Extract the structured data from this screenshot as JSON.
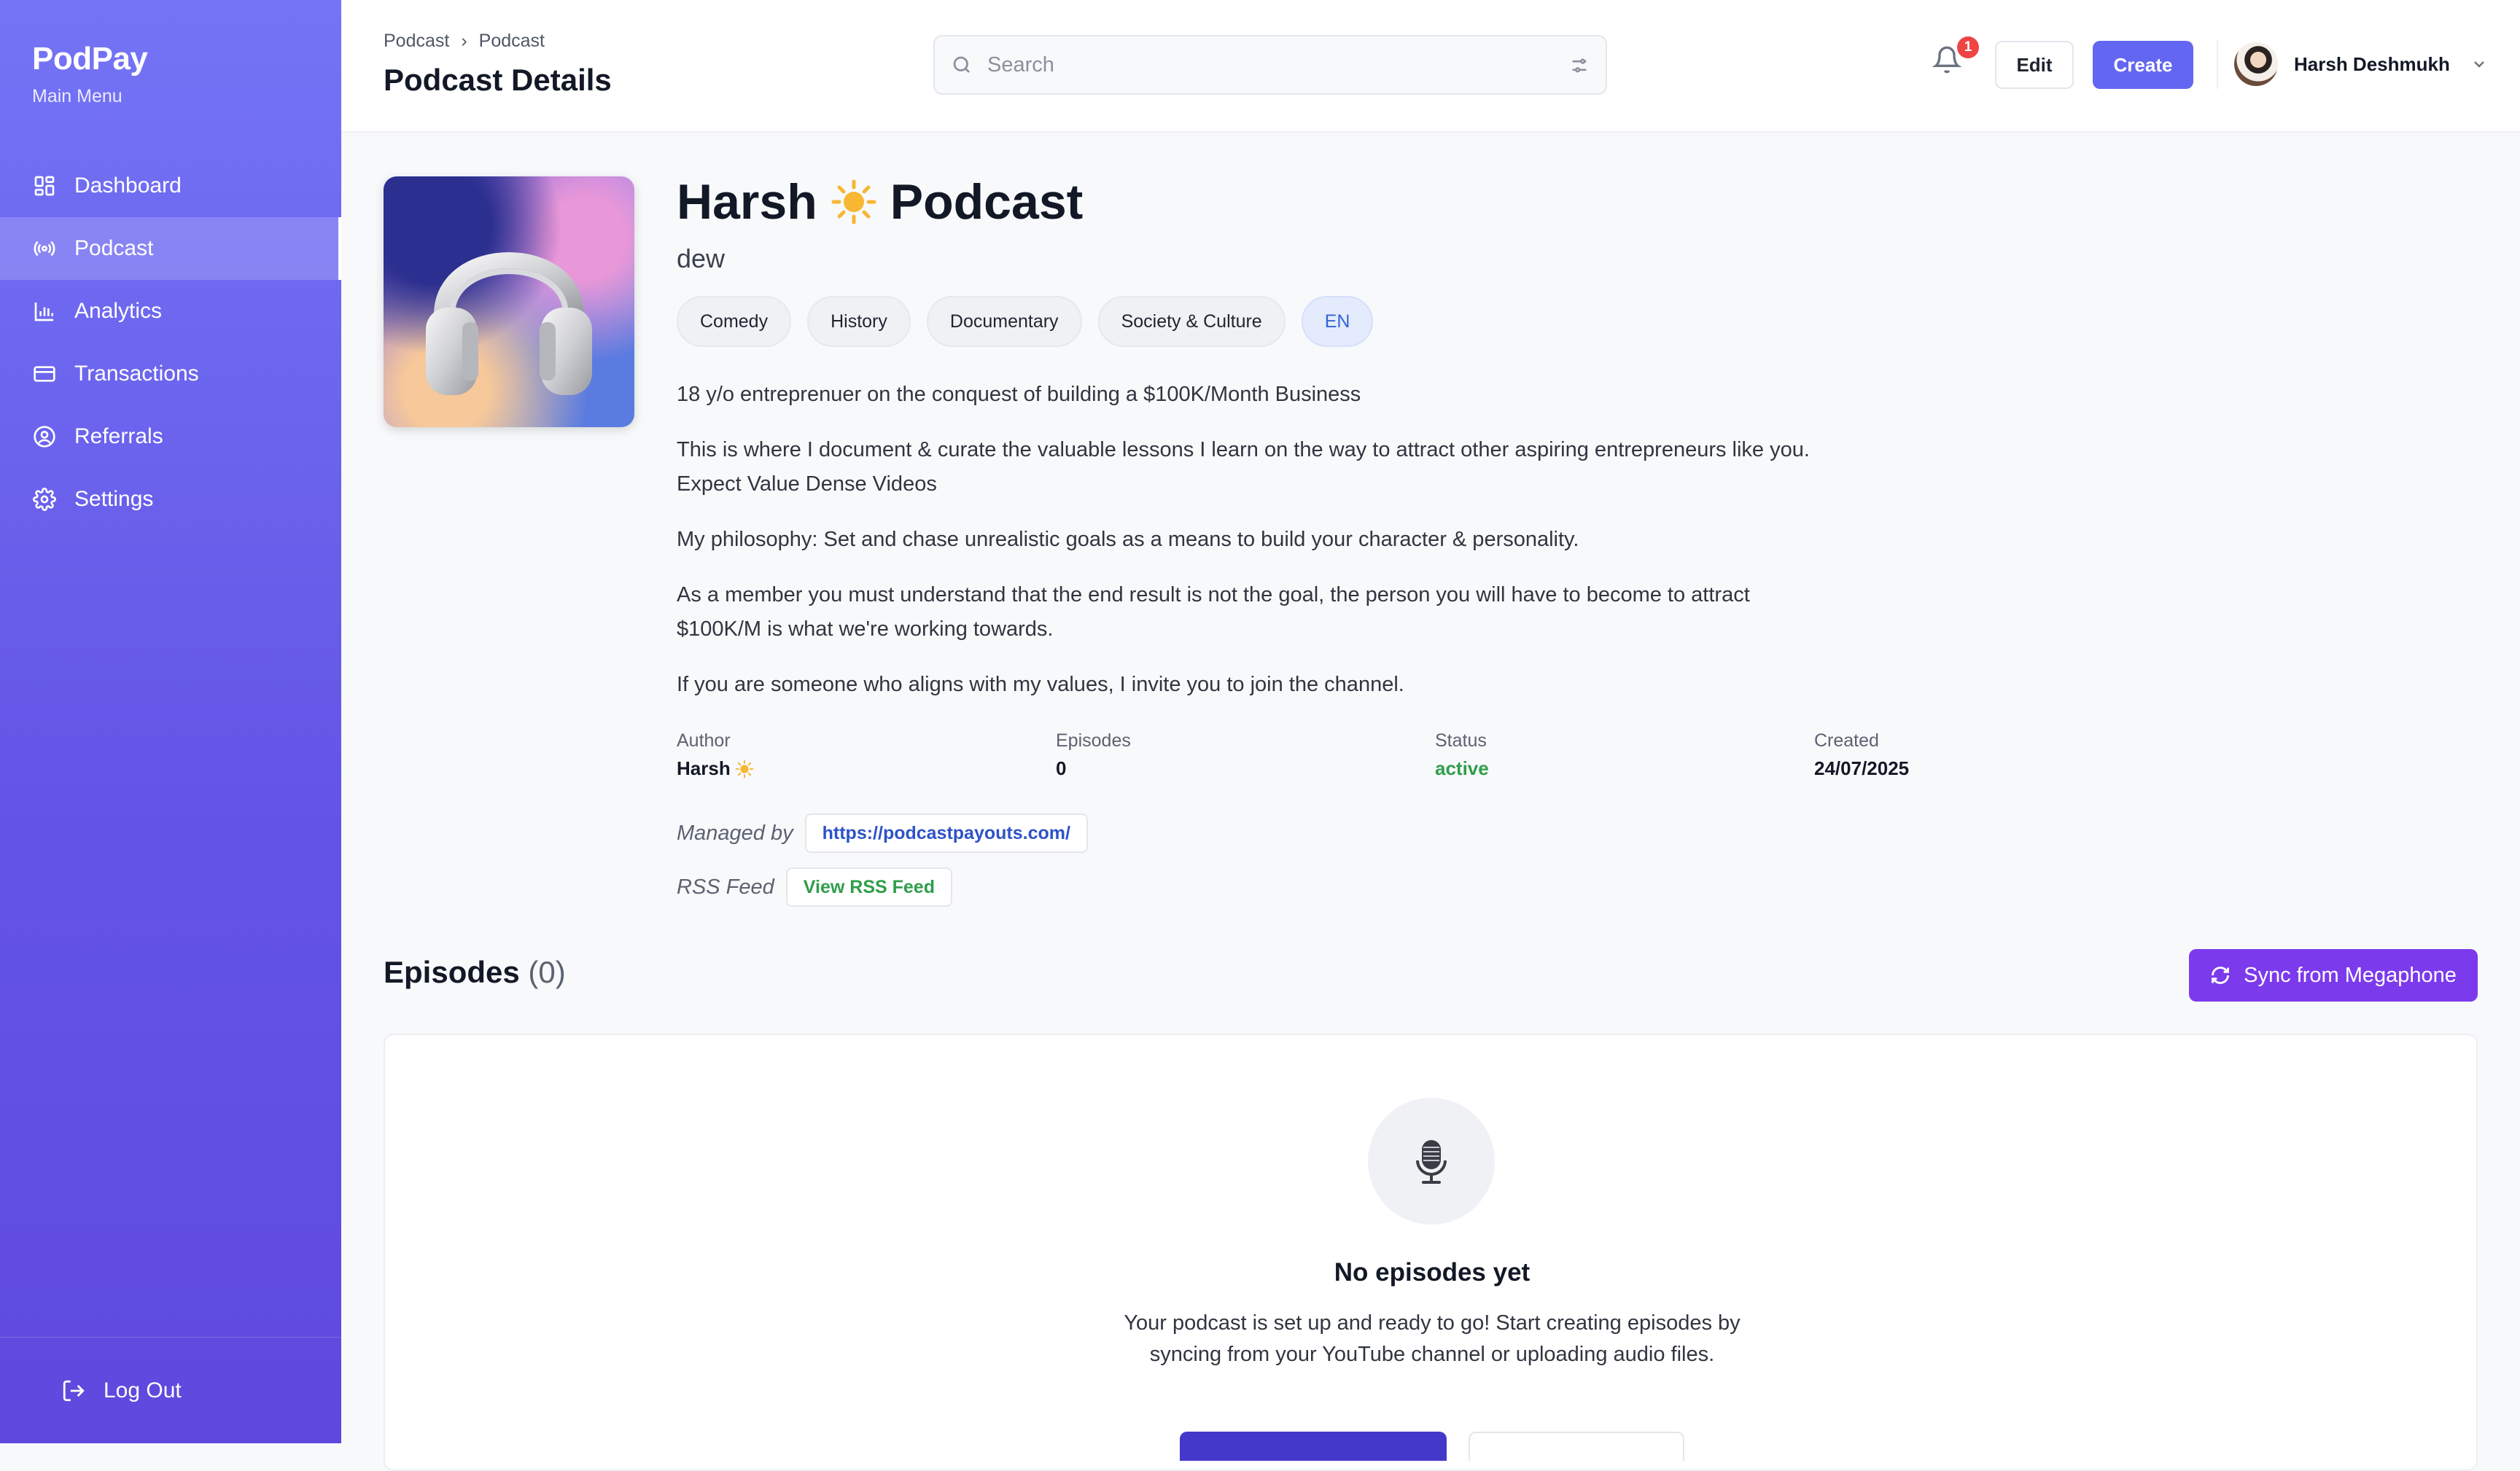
{
  "app": {
    "name": "PodPay",
    "subtitle": "Main Menu"
  },
  "sidebar": {
    "items": [
      {
        "label": "Dashboard",
        "icon": "dashboard-icon",
        "active": false
      },
      {
        "label": "Podcast",
        "icon": "podcast-icon",
        "active": true
      },
      {
        "label": "Analytics",
        "icon": "analytics-icon",
        "active": false
      },
      {
        "label": "Transactions",
        "icon": "card-icon",
        "active": false
      },
      {
        "label": "Referrals",
        "icon": "user-circle-icon",
        "active": false
      },
      {
        "label": "Settings",
        "icon": "gear-icon",
        "active": false
      }
    ],
    "logout_label": "Log Out"
  },
  "header": {
    "breadcrumb": [
      "Podcast",
      "Podcast"
    ],
    "breadcrumb_sep": "›",
    "title": "Podcast Details",
    "search_placeholder": "Search",
    "notification_count": "1",
    "edit_label": "Edit",
    "create_label": "Create",
    "user_name": "Harsh Deshmukh"
  },
  "podcast": {
    "title_part1": "Harsh",
    "title_part2": "Podcast",
    "subtitle": "dew",
    "tags": [
      "Comedy",
      "History",
      "Documentary",
      "Society & Culture"
    ],
    "language": "EN",
    "description": [
      "18 y/o entreprenuer on the conquest of building a $100K/Month Business",
      "This is where I document & curate the valuable lessons I learn on the way to attract other aspiring entrepreneurs like you.\nExpect Value Dense Videos",
      "My philosophy: Set and chase unrealistic goals as a means to build your character & personality.",
      "As a member you must understand that the end result is not the goal, the person you will have to become to attract\n$100K/M is what we're working towards.",
      "If you are someone who aligns with my values, I invite you to join the channel."
    ],
    "meta": {
      "author_label": "Author",
      "author_value": "Harsh",
      "episodes_label": "Episodes",
      "episodes_value": "0",
      "status_label": "Status",
      "status_value": "active",
      "created_label": "Created",
      "created_value": "24/07/2025"
    },
    "managed_label": "Managed by",
    "managed_url": "https://podcastpayouts.com/",
    "rss_label": "RSS Feed",
    "rss_link": "View RSS Feed"
  },
  "episodes": {
    "title": "Episodes",
    "count": "(0)",
    "sync_label": "Sync from Megaphone",
    "empty_title": "No episodes yet",
    "empty_text": "Your podcast is set up and ready to go! Start creating episodes by syncing from your YouTube channel or uploading audio files."
  },
  "colors": {
    "accent": "#6366f1",
    "sync": "#7c3aed",
    "status_active": "#2e9e4a",
    "link": "#2e52c9"
  }
}
